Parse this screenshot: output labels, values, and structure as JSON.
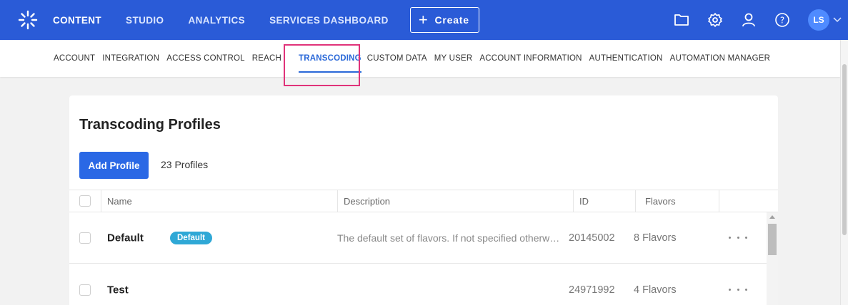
{
  "nav": {
    "items": [
      "CONTENT",
      "STUDIO",
      "ANALYTICS",
      "SERVICES DASHBOARD"
    ],
    "create_label": "Create",
    "avatar_initials": "LS"
  },
  "subnav": {
    "items": [
      "ACCOUNT",
      "INTEGRATION",
      "ACCESS CONTROL",
      "REACH",
      "TRANSCODING",
      "CUSTOM DATA",
      "MY USER",
      "ACCOUNT INFORMATION",
      "AUTHENTICATION",
      "AUTOMATION MANAGER"
    ],
    "active": "TRANSCODING"
  },
  "page": {
    "title": "Transcoding Profiles",
    "add_button": "Add Profile",
    "profile_count": "23 Profiles"
  },
  "table": {
    "headers": [
      "Name",
      "Description",
      "ID",
      "Flavors"
    ],
    "rows": [
      {
        "name": "Default",
        "badge": "Default",
        "description": "The default set of flavors. If not specified otherwise all uploaded videos will be converted using this set of flavors",
        "id": "20145002",
        "flavors": "8 Flavors"
      },
      {
        "name": "Test",
        "badge": "",
        "description": "",
        "id": "24971992",
        "flavors": "4 Flavors"
      }
    ]
  },
  "colors": {
    "topbar": "#2a5bd7",
    "accent": "#2a68d8",
    "highlight": "#e0337a",
    "badge": "#2fa8d6"
  }
}
